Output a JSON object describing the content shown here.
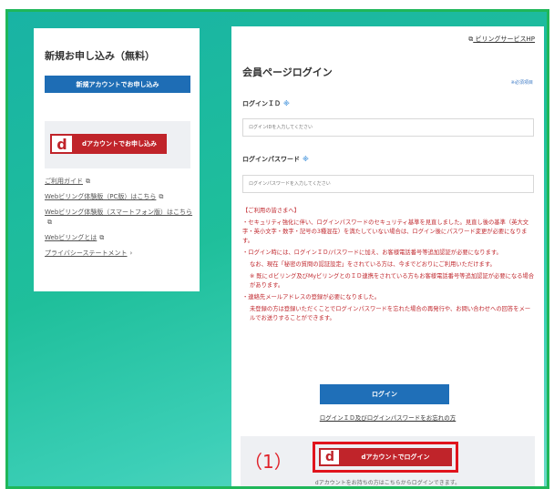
{
  "left": {
    "title": "新規お申し込み（無料）",
    "new_account_button": "新規アカウントでお申し込み",
    "d_logo": "d",
    "d_apply_button": "dアカウントでお申し込み",
    "links": [
      "ご利用ガイド",
      "Webビリング体験版（PC版）はこちら",
      "Webビリング体験版（スマートフォン版）はこちら",
      "Webビリングとは",
      "プライバシーステートメント"
    ]
  },
  "right": {
    "billing_hp_link": "ビリングサービスHP",
    "title": "会員ページログイン",
    "required_note": "※必須項目",
    "login_id_label": "ログインＩＤ",
    "login_id_placeholder": "ログインIDを入力してください",
    "password_label": "ログインパスワード",
    "password_placeholder": "ログインパスワードを入力してください",
    "required_mark": "※",
    "notice": {
      "heading": "【ご利用の皆さまへ】",
      "item1": "・セキュリティ強化に伴い、ログインパスワードのセキュリティ基準を見直しました。見直し後の基準（英大文字・英小文字・数字・記号の3種混在）を満たしていない場合は、ログイン後にパスワード変更が必要になります。",
      "item2": "・ログイン時には、ログインＩＤ/パスワードに加え、お客様電話番号等追加認証が必要になります。",
      "item2b": "なお、現在「秘密の質問の認証設定」をされている方は、今までどおりにご利用いただけます。",
      "item3": "※ 既にｄビリング及びMyビリングとのＩＤ連携をされている方もお客様電話番号等追加認証が必要になる場合があります。",
      "item4": "・連絡先メールアドレスの登録が必要になりました。",
      "item4b": "未登録の方は登録いただくことでログインパスワードを忘れた場合の再発行や、お問い合わせへの回答をメールでお送りすることができます。"
    },
    "login_button": "ログイン",
    "forgot_link": "ログインＩＤ及びログインパスワードをお忘れの方",
    "annotation_label": "（1）",
    "d_logo": "d",
    "d_login_button": "dアカウントでログイン",
    "d_login_note": "dアカウントをお持ちの方はこちらからログインできます。"
  },
  "colors": {
    "accent_blue": "#1f6fb8",
    "docomo_red": "#c0242a",
    "highlight_red": "#e0141c",
    "frame_green": "#1fb75a"
  }
}
